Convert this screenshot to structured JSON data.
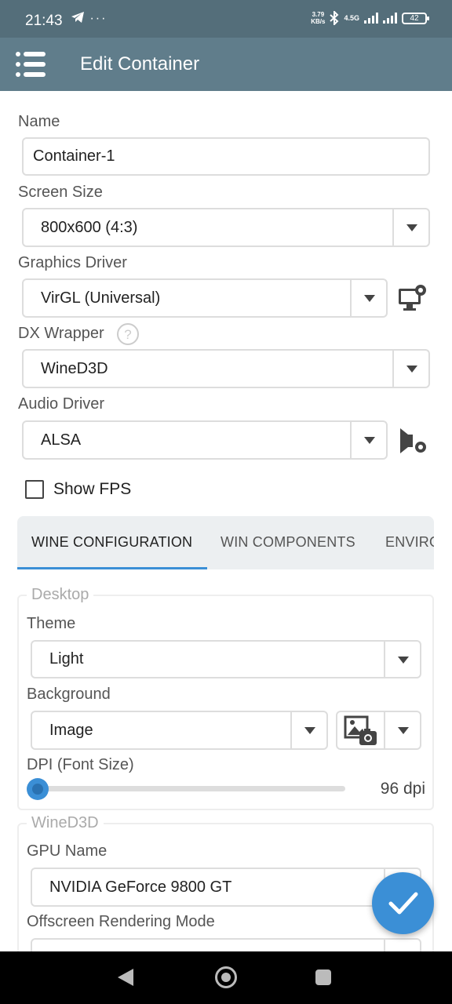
{
  "status_bar": {
    "time": "21:43",
    "left_icons": [
      "telegram-icon",
      "more-icon"
    ],
    "net_speed_value": "3.79",
    "net_speed_unit": "KB/s",
    "network_type": "4.5G",
    "battery": "42"
  },
  "app_bar": {
    "title": "Edit Container",
    "menu_icon": "menu-icon"
  },
  "form": {
    "name_label": "Name",
    "name_value": "Container-1",
    "screen_size_label": "Screen Size",
    "screen_size_value": "800x600 (4:3)",
    "graphics_driver_label": "Graphics Driver",
    "graphics_driver_value": "VirGL (Universal)",
    "dx_wrapper_label": "DX Wrapper",
    "dx_wrapper_value": "WineD3D",
    "audio_driver_label": "Audio Driver",
    "audio_driver_value": "ALSA",
    "show_fps_label": "Show FPS",
    "show_fps_checked": false
  },
  "tabs": [
    "WINE CONFIGURATION",
    "WIN COMPONENTS",
    "ENVIRO"
  ],
  "active_tab": 0,
  "desktop": {
    "legend": "Desktop",
    "theme_label": "Theme",
    "theme_value": "Light",
    "background_label": "Background",
    "background_value": "Image",
    "dpi_label": "DPI (Font Size)",
    "dpi_value": "96 dpi",
    "dpi_slider_level": 0
  },
  "wined3d": {
    "legend": "WineD3D",
    "gpu_name_label": "GPU Name",
    "gpu_name_value": "NVIDIA GeForce 9800 GT",
    "offscreen_label": "Offscreen Rendering Mode"
  },
  "colors": {
    "status_bar": "#546e7a",
    "app_bar": "#607d8b",
    "accent": "#3b8fd6"
  }
}
